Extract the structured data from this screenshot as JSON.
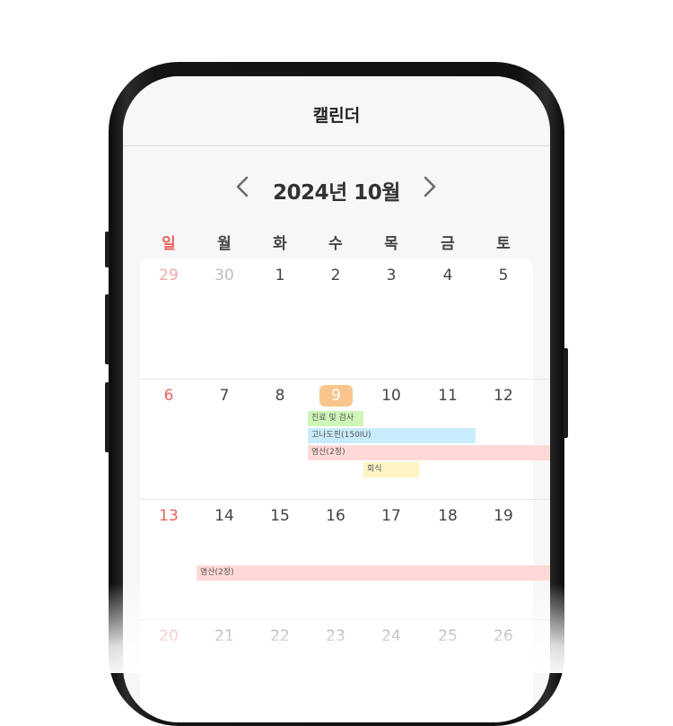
{
  "header": {
    "title": "캘린더"
  },
  "month_nav": {
    "title": "2024년 10월"
  },
  "weekdays": [
    "일",
    "월",
    "화",
    "수",
    "목",
    "금",
    "토"
  ],
  "weeks": [
    [
      "29",
      "30",
      "1",
      "2",
      "3",
      "4",
      "5"
    ],
    [
      "6",
      "7",
      "8",
      "9",
      "10",
      "11",
      "12"
    ],
    [
      "13",
      "14",
      "15",
      "16",
      "17",
      "18",
      "19"
    ],
    [
      "20",
      "21",
      "22",
      "23",
      "24",
      "25",
      "26"
    ]
  ],
  "events": [
    {
      "label": "진료 및 검사"
    },
    {
      "label": "고나도핀(150IU)"
    },
    {
      "label": "염산(2정)"
    },
    {
      "label": "회식"
    },
    {
      "label": "염산(2정)"
    }
  ],
  "colors": {
    "accent_today": "#f9c58c",
    "sunday": "#e8625f",
    "event_green": "#cff5b8",
    "event_blue": "#c9ecfb",
    "event_pink": "#ffd9d7",
    "event_yellow": "#fff5c4"
  }
}
